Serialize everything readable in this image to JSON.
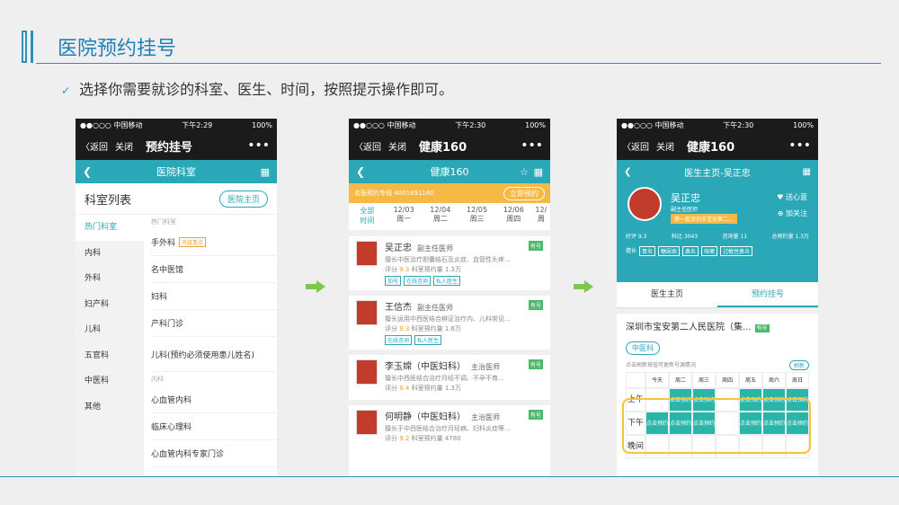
{
  "slide": {
    "title": "医院预约挂号",
    "subtitle": "选择你需要就诊的科室、医生、时间，按照提示操作即可。"
  },
  "phone1": {
    "status": {
      "carrier": "●●○○○ 中国移动",
      "time": "下午2:29",
      "battery": "100%"
    },
    "nav": {
      "back": "〈返回",
      "close": "关闭",
      "title": "预约挂号",
      "more": "•••"
    },
    "teal_title": "医院科室",
    "list_title": "科室列表",
    "home_button": "医院主页",
    "left_items": [
      "热门科室",
      "内科",
      "外科",
      "妇产科",
      "儿科",
      "五官科",
      "中医科",
      "其他"
    ],
    "hot_label": "热门科室",
    "hot_items": [
      "手外科",
      "名中医馆",
      "妇科",
      "产科门诊",
      "儿科(预约必须使用患儿姓名)"
    ],
    "hot_badge": "市级重点",
    "internal_label": "内科",
    "internal_items": [
      "心血管内科",
      "临床心理科",
      "心血管内科专家门诊"
    ]
  },
  "phone2": {
    "status": {
      "carrier": "●●○○○ 中国移动",
      "time": "下午2:30",
      "battery": "100%"
    },
    "nav": {
      "back": "〈返回",
      "close": "关闭",
      "title": "健康160",
      "more": "•••"
    },
    "teal_title": "健康160",
    "hotline": "名医预约专线 4001891160",
    "book_button": "立即预约",
    "dates": [
      {
        "d": "全部",
        "w": "时间"
      },
      {
        "d": "12/03",
        "w": "周一"
      },
      {
        "d": "12/04",
        "w": "周二"
      },
      {
        "d": "12/05",
        "w": "周三"
      },
      {
        "d": "12/06",
        "w": "周四"
      },
      {
        "d": "12/",
        "w": "周"
      }
    ],
    "doctors": [
      {
        "name": "吴正忠",
        "title": "副主任医师",
        "desc": "擅长中医治疗胆囊结石及炎症、血管性头疼...",
        "score": "9.3",
        "count": "科室预约量 1.3万",
        "tags": [
          "加号",
          "在线咨询",
          "私人医生"
        ],
        "badge": "有号"
      },
      {
        "name": "王信杰",
        "title": "副主任医师",
        "desc": "擅长运用中西医结合辨证治疗内、儿科常见...",
        "score": "9.3",
        "count": "科室预约量 1.6万",
        "tags": [
          "在线咨询",
          "私人医生"
        ],
        "badge": "有号"
      },
      {
        "name": "李玉嫦（中医妇科）",
        "title": "主治医师",
        "desc": "擅长中西医结合治疗月经不调、不孕不育...",
        "score": "9.4",
        "count": "科室预约量 1.3万",
        "tags": [],
        "badge": "有号"
      },
      {
        "name": "何明静（中医妇科）",
        "title": "主治医师",
        "desc": "擅长于中西医结合治疗月经病、妇科炎症等...",
        "score": "9.2",
        "count": "科室预约量 4780",
        "tags": [],
        "badge": "有号"
      }
    ],
    "score_label": "评分"
  },
  "phone3": {
    "status": {
      "carrier": "●●○○○ 中国移动",
      "time": "下午2:30",
      "battery": "100%"
    },
    "nav": {
      "back": "〈返回",
      "close": "关闭",
      "title": "健康160",
      "more": "•••"
    },
    "teal_title": "医生主页-吴正忠",
    "doctor_name": "吴正忠",
    "doctor_title": "副主任医师",
    "doctor_inst": "第一批深圳市宝安第二...",
    "follow1": "♥ 送心意",
    "follow2": "⊕ 加关注",
    "stats": [
      "好评 9.3",
      "科比 3043",
      "咨询量 11",
      "总预约量 1.3万"
    ],
    "good_label": "擅长",
    "good_tags": [
      "胃炎",
      "糖尿病",
      "鼻炎",
      "咳嗽",
      "过敏性鼻炎"
    ],
    "tabs": [
      "医生主页",
      "预约挂号"
    ],
    "hospital": "深圳市宝安第二人民医院（集...",
    "hospital_badge": "有号",
    "dept_tag": "中医科",
    "sched_note": "点击刷新按钮可更新号源情况",
    "refresh": "刷新",
    "days": [
      "今天",
      "周二",
      "周三",
      "周四",
      "周五",
      "周六",
      "周日"
    ],
    "slot_labels": [
      "上午",
      "下午",
      "晚间"
    ],
    "slot_text": "点击预约"
  }
}
